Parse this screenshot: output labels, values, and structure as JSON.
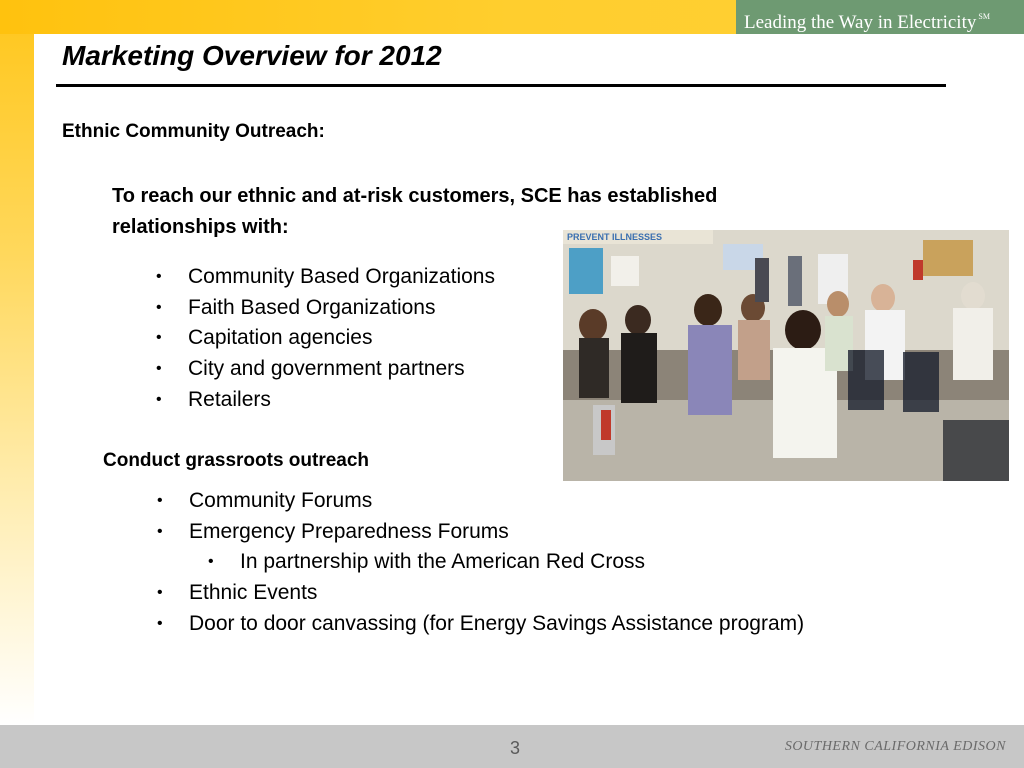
{
  "header": {
    "tagline": "Leading the Way in Electricity",
    "tagline_mark": "SM"
  },
  "slide": {
    "title": "Marketing Overview for 2012",
    "section1_heading": "Ethnic  Community Outreach:",
    "intro_line1": "To reach our ethnic and at-risk customers, SCE has established",
    "intro_line2": "relationships with:",
    "relationships": [
      "Community Based Organizations",
      "Faith Based Organizations",
      "Capitation agencies",
      "City and government partners",
      "Retailers"
    ],
    "section2_heading": "Conduct grassroots outreach",
    "outreach": [
      {
        "text": "Community Forums",
        "level": 1
      },
      {
        "text": "Emergency Preparedness Forums",
        "level": 1
      },
      {
        "text": "In partnership with the American Red Cross",
        "level": 2
      },
      {
        "text": "Ethnic Events",
        "level": 1
      },
      {
        "text": "Door to door canvassing  (for Energy Savings Assistance program)",
        "level": 1
      }
    ],
    "photo_banner_text": "PREVENT ILLNESSES",
    "bullet_glyph": "•"
  },
  "footer": {
    "page_number": "3",
    "company": "SOUTHERN CALIFORNIA EDISON"
  },
  "colors": {
    "top_bar": "#ffc20e",
    "tagline_bg": "#6e9a72",
    "footer_bg": "#c7c7c7"
  }
}
